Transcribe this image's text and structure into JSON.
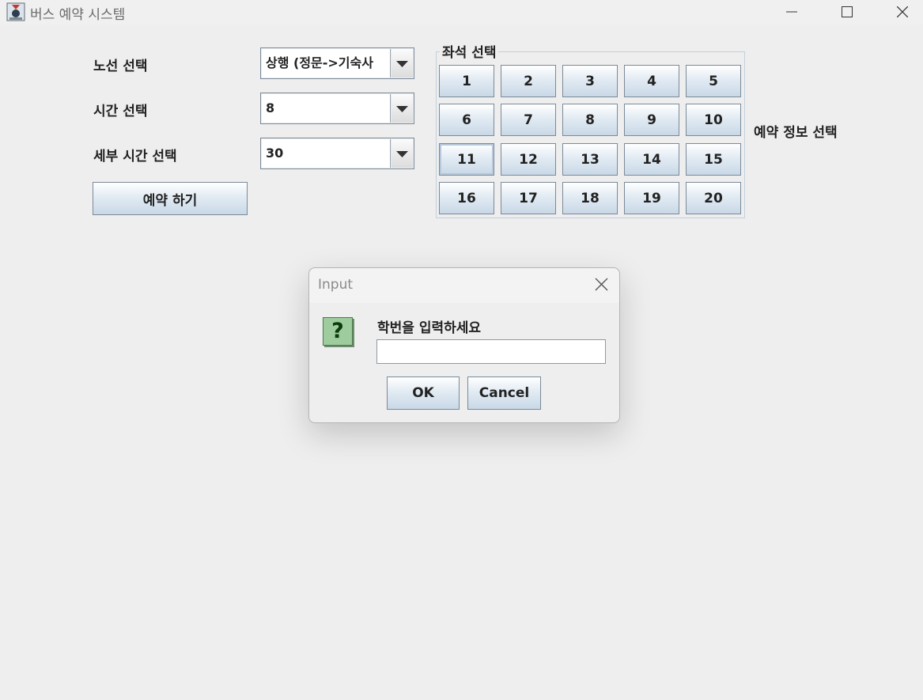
{
  "window": {
    "title": "버스 예약 시스템",
    "controls": [
      "minimize-icon",
      "maximize-icon",
      "close-icon"
    ]
  },
  "form": {
    "route_label": "노선 선택",
    "route_value": "상행 (정문->기숙사",
    "time_label": "시간 선택",
    "time_value": "8",
    "minute_label": "세부 시간 선택",
    "minute_value": "30",
    "reserve_button": "예약 하기"
  },
  "seats": {
    "legend": "좌석 선택",
    "labels": [
      "1",
      "2",
      "3",
      "4",
      "5",
      "6",
      "7",
      "8",
      "9",
      "10",
      "11",
      "12",
      "13",
      "14",
      "15",
      "16",
      "17",
      "18",
      "19",
      "20"
    ],
    "focused": "11"
  },
  "info_label": "예약 정보 선택",
  "dialog": {
    "title": "Input",
    "message": "학번을 입력하세요",
    "input_value": "",
    "ok": "OK",
    "cancel": "Cancel",
    "icon": "question-icon",
    "icon_glyph": "?"
  },
  "colors": {
    "button_border": "#7a8a99",
    "button_gradient_bottom": "#c9d8e7",
    "question_icon_bg": "#9fcc9f"
  }
}
